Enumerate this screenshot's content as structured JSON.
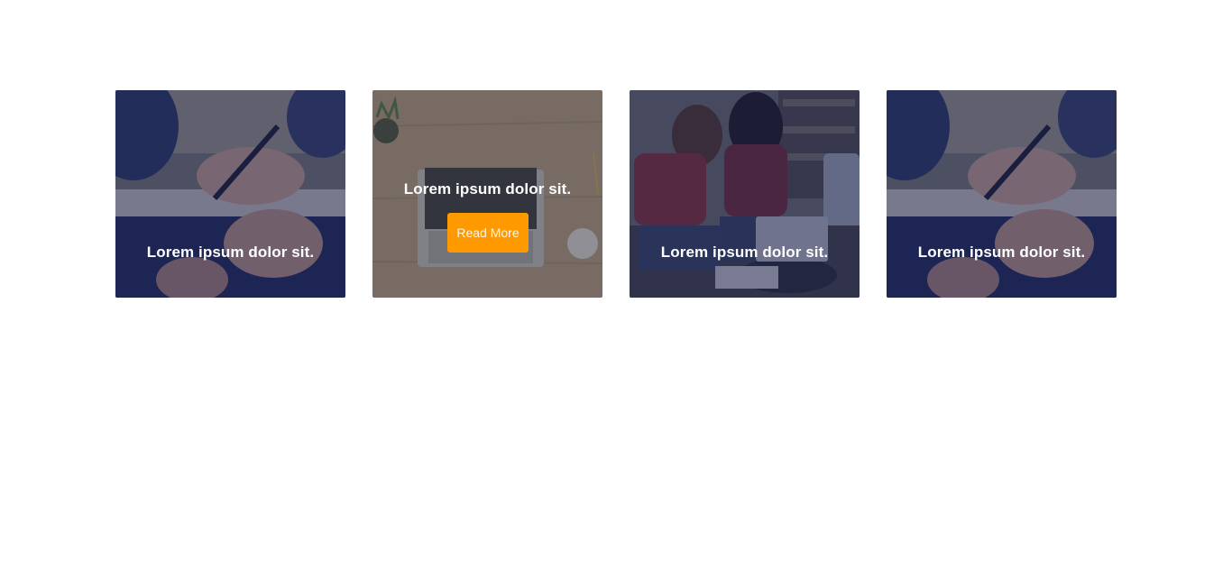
{
  "cards": [
    {
      "title": "Lorem ipsum dolor sit.",
      "image": "writing-notebook-photo"
    },
    {
      "title": "Lorem ipsum dolor sit.",
      "image": "laptop-desk-photo",
      "button_label": "Read More",
      "hovered": true
    },
    {
      "title": "Lorem ipsum dolor sit.",
      "image": "students-laptop-photo"
    },
    {
      "title": "Lorem ipsum dolor sit.",
      "image": "writing-notebook-photo"
    }
  ],
  "colors": {
    "accent": "#ff9900",
    "overlay_navy": "#1c2350",
    "text": "#ffffff"
  }
}
